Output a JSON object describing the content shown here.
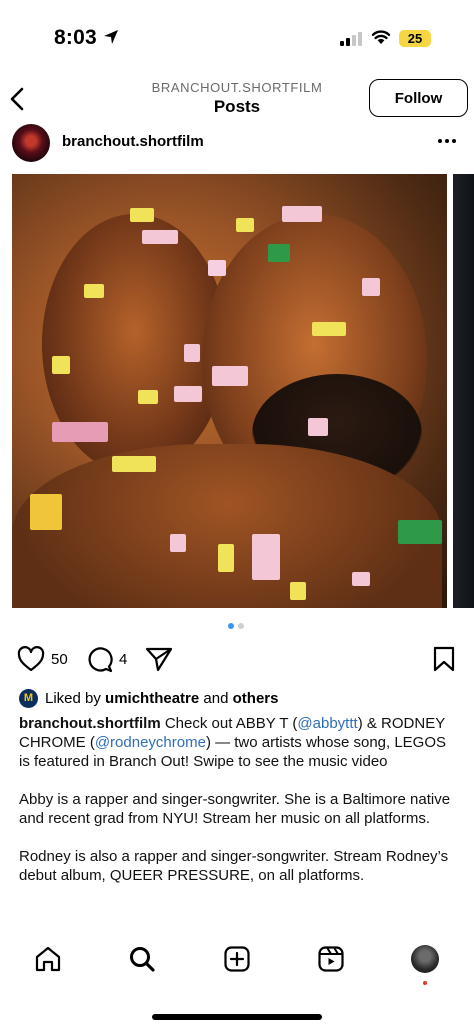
{
  "status_bar": {
    "time": "8:03",
    "battery": "25",
    "icons": [
      "location-arrow-icon",
      "signal-icon",
      "wifi-icon",
      "battery-icon"
    ]
  },
  "header": {
    "account": "BRANCHOUT.SHORTFILM",
    "title": "Posts",
    "follow_label": "Follow",
    "icons": [
      "chevron-left-icon"
    ]
  },
  "post": {
    "username": "branchout.shortfilm",
    "image_count": 2,
    "current_image": 1,
    "likes": "50",
    "comments": "4",
    "liked_by": {
      "prefix": "Liked by ",
      "user": "umichtheatre",
      "middle": " and ",
      "others": "others",
      "avatar_letter": "M"
    },
    "caption": {
      "username": "branchout.shortfilm",
      "p1_a": " Check out ABBY T (",
      "mention1": "@abbyttt",
      "p1_b": ") & RODNEY CHROME (",
      "mention2": "@rodneychrome",
      "p1_c": ") — two artists whose song, LEGOS is featured in Branch Out! Swipe to see the music video",
      "p2": "Abby is a rapper and singer-songwriter. She is a Baltimore native and recent grad from NYU! Stream her music on all platforms.",
      "p3": "Rodney is also a rapper and singer-songwriter. Stream Rodney’s debut album, QUEER PRESSURE, on all platforms."
    }
  },
  "tab_bar": {
    "items": [
      "home-icon",
      "search-icon",
      "new-post-icon",
      "reels-icon",
      "profile-avatar"
    ],
    "active": "search-icon"
  },
  "colors": {
    "link": "#2f6fb5",
    "dot_active": "#3897f0",
    "battery": "#f6d743",
    "notif": "#e3342f"
  }
}
